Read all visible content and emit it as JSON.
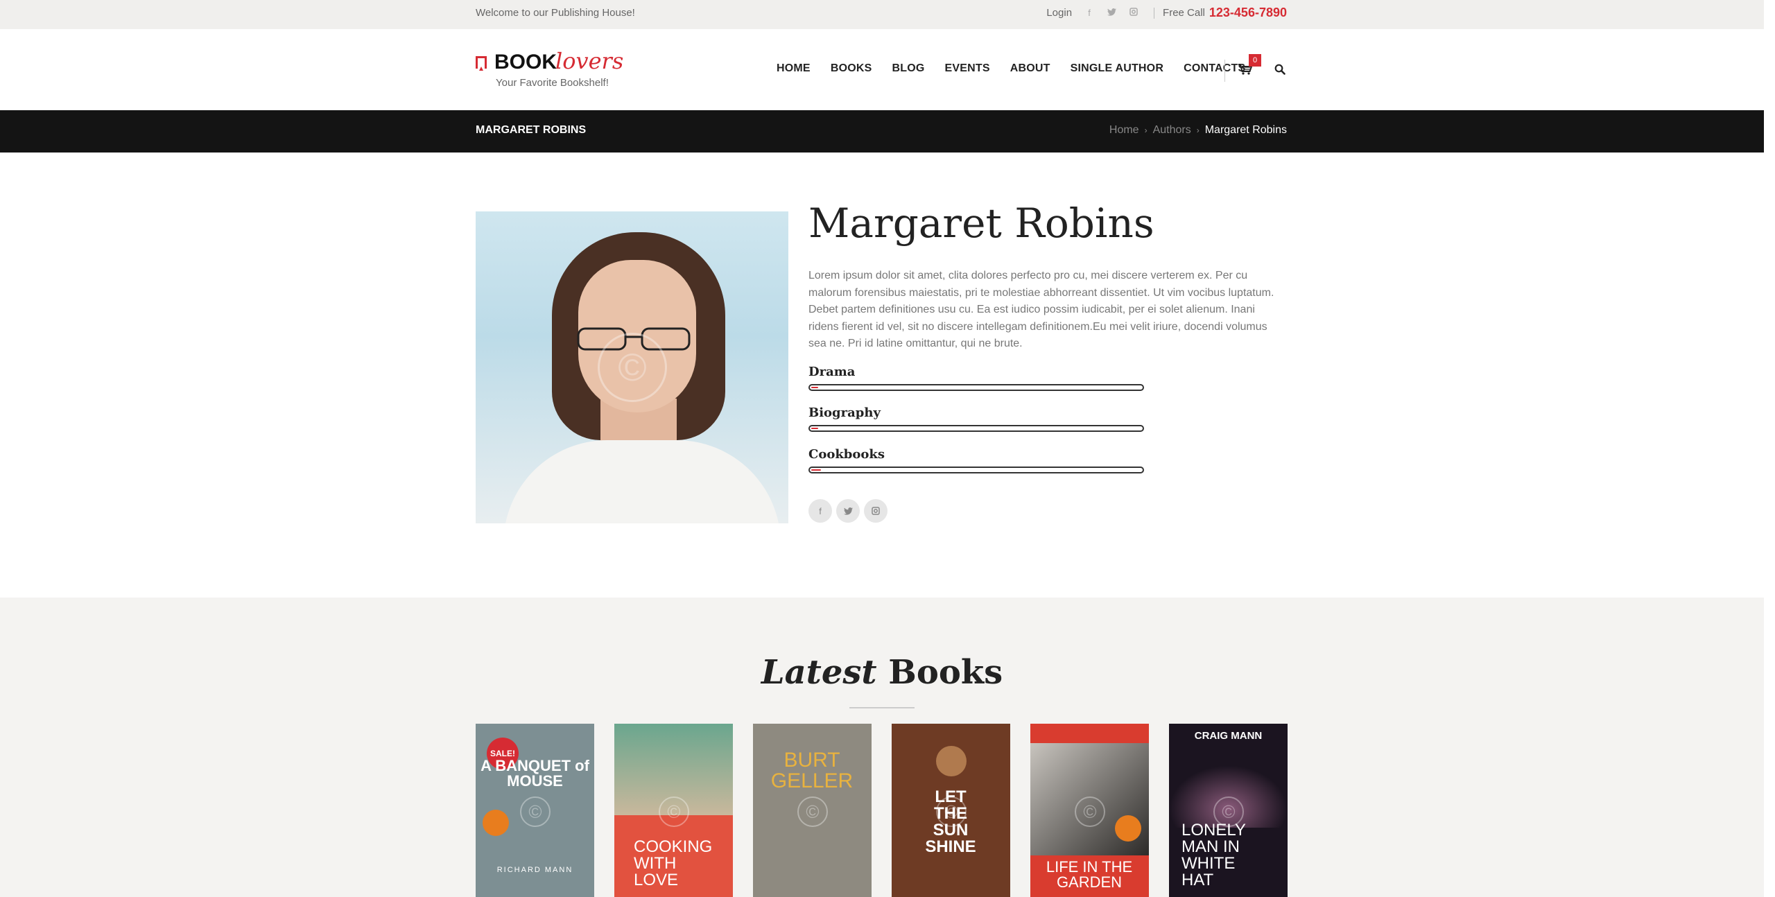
{
  "topbar": {
    "welcome": "Welcome to our Publishing House!",
    "login": "Login",
    "social_icons": [
      "facebook-icon",
      "twitter-icon",
      "instagram-icon"
    ],
    "free_call_label": "Free Call",
    "phone": "123-456-7890"
  },
  "header": {
    "logo_book": "BOOK",
    "logo_lovers": "lovers",
    "tagline": "Your Favorite Bookshelf!",
    "nav": [
      "HOME",
      "BOOKS",
      "BLOG",
      "EVENTS",
      "ABOUT",
      "SINGLE AUTHOR",
      "CONTACTS"
    ],
    "cart_count": "0",
    "icons": [
      "cart-icon",
      "search-icon"
    ]
  },
  "breadcrumb": {
    "page_title": "MARGARET ROBINS",
    "items": [
      "Home",
      "Authors",
      "Margaret Robins"
    ]
  },
  "author": {
    "name": "Margaret Robins",
    "bio": "Lorem ipsum dolor sit amet, clita dolores perfecto pro cu, mei discere verterem ex. Per cu malorum forensibus maiestatis, pri te molestiae abhorreant dissentiet. Ut vim vocibus luptatum. Debet partem definitiones usu cu. Ea est iudico possim iudicabit, per ei solet alienum. Inani ridens fierent id vel, sit no discere intellegam definitionem.Eu mei velit iriure, docendi volumus sea ne. Pri id latine omittantur, qui ne brute.",
    "skills": [
      {
        "label": "Drama",
        "level": 0.02
      },
      {
        "label": "Biography",
        "level": 0.02
      },
      {
        "label": "Cookbooks",
        "level": 0.03
      }
    ],
    "social_icons": [
      "facebook-icon",
      "twitter-icon",
      "instagram-icon"
    ]
  },
  "latest": {
    "heading_em": "Latest",
    "heading_rest": "Books",
    "books": [
      {
        "title": "A BANQUET of MOUSE",
        "author": "RICHARD MANN",
        "sale": "SALE!",
        "color": "#7d8f93"
      },
      {
        "title": "COOKING WITH LOVE",
        "author": "",
        "sale": "",
        "color": "#e2523f"
      },
      {
        "title": "BURT GELLER",
        "author": "",
        "sale": "",
        "color": "#8e8a80"
      },
      {
        "title": "LET THE SUN SHINE",
        "author": "",
        "sale": "",
        "color": "#6e3b24"
      },
      {
        "title": "LIFE IN THE GARDEN",
        "author": "",
        "sale": "",
        "color": "#d93c2f"
      },
      {
        "title": "LONELY MAN IN WHITE HAT",
        "author": "CRAIG MANN",
        "sale": "",
        "color": "#1b1420"
      }
    ]
  },
  "colors": {
    "accent": "#d62b33",
    "dark_bar": "#141414",
    "topbar_bg": "#f0efed",
    "section_bg": "#f4f3f1"
  }
}
